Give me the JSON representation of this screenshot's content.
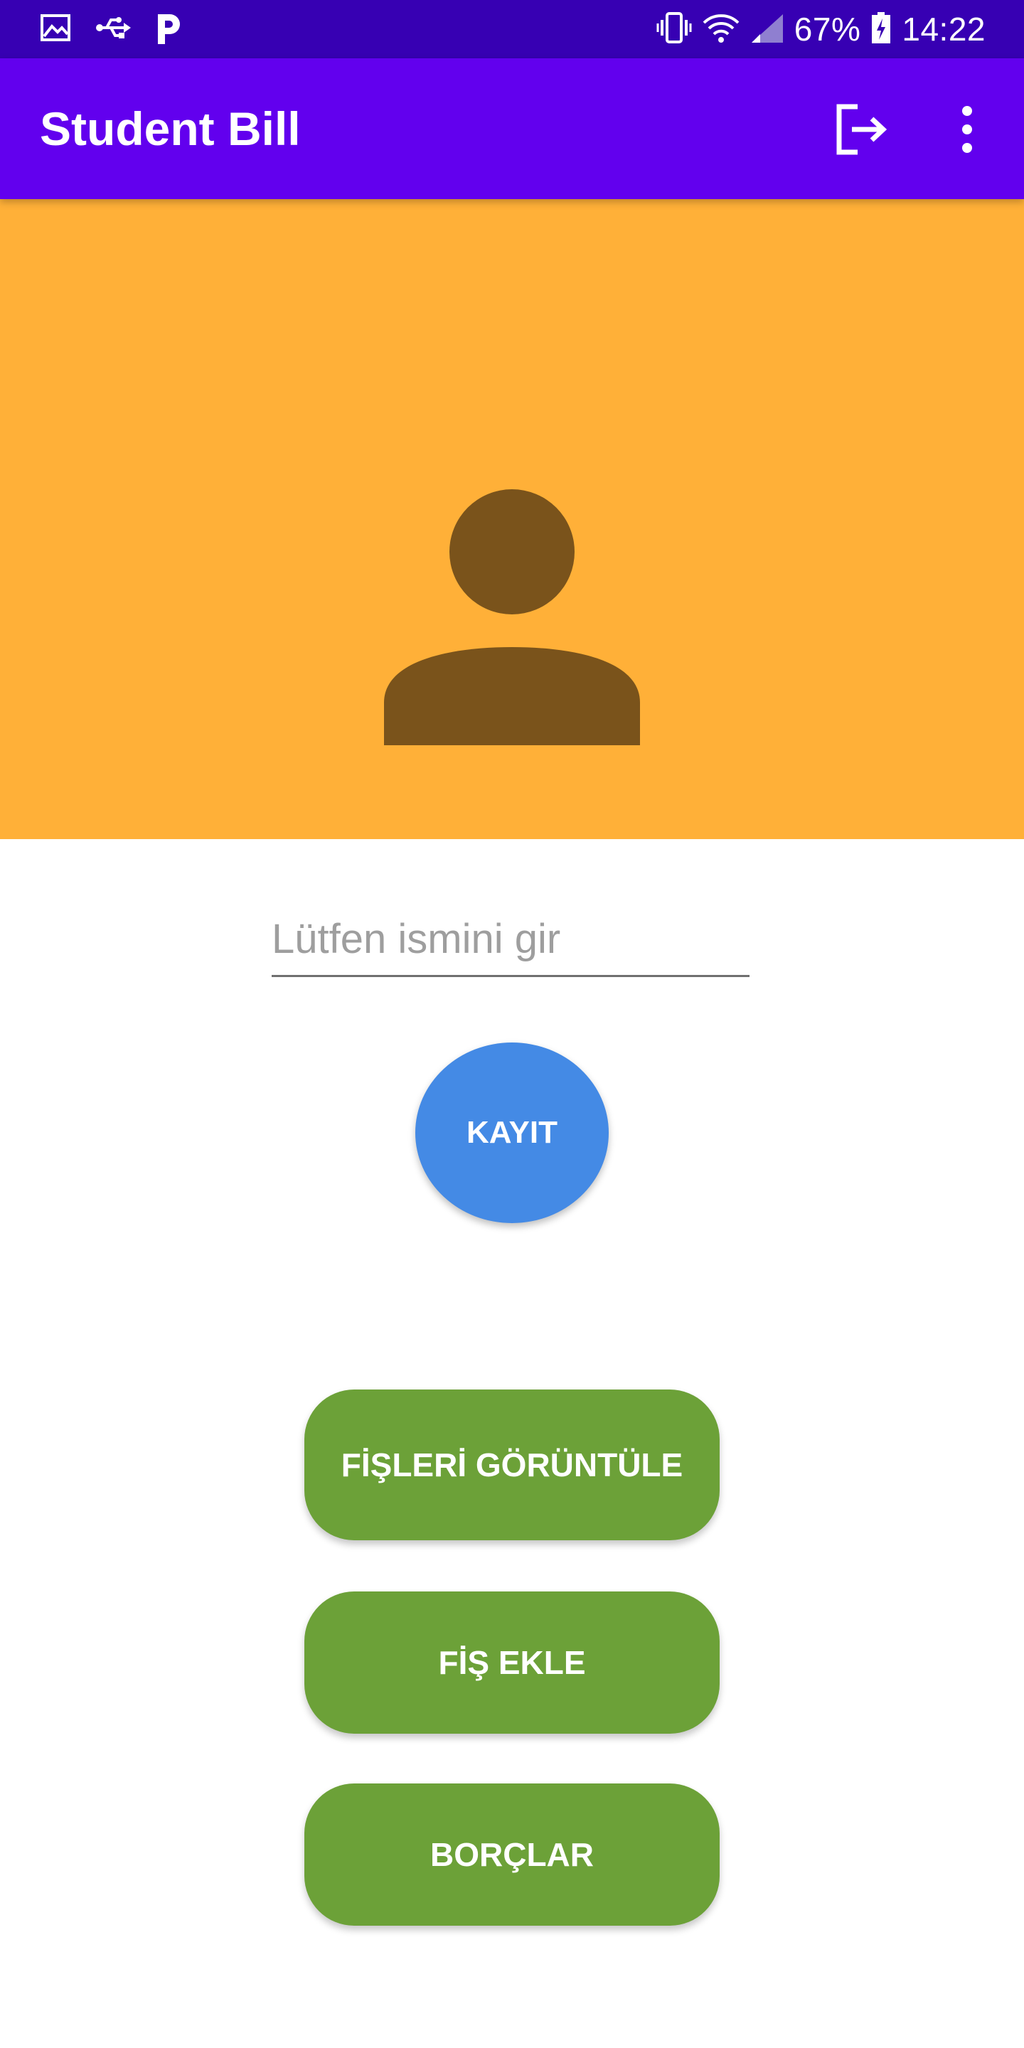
{
  "status_bar": {
    "icons": [
      "gallery-icon",
      "usb-icon",
      "parking-app-icon",
      "vibrate-icon",
      "wifi-icon",
      "signal-icon",
      "battery-icon"
    ],
    "battery": "67%",
    "time": "14:22",
    "background": "#3700b3"
  },
  "app_bar": {
    "title": "Student Bill",
    "actions": [
      "logout-icon",
      "more-vert-icon"
    ],
    "background": "#6200ee"
  },
  "header": {
    "background": "#ffb038",
    "avatar_icon": "person-icon",
    "avatar_color": "#7a531b"
  },
  "form": {
    "name_placeholder": "Lütfen ismini gir",
    "name_value": "",
    "save_label": "KAYIT",
    "save_color": "#448ae5"
  },
  "actions": {
    "color": "#6ca138",
    "view_receipts": "FİŞLERİ GÖRÜNTÜLE",
    "add_receipt": "FİŞ EKLE",
    "debts": "BORÇLAR"
  }
}
